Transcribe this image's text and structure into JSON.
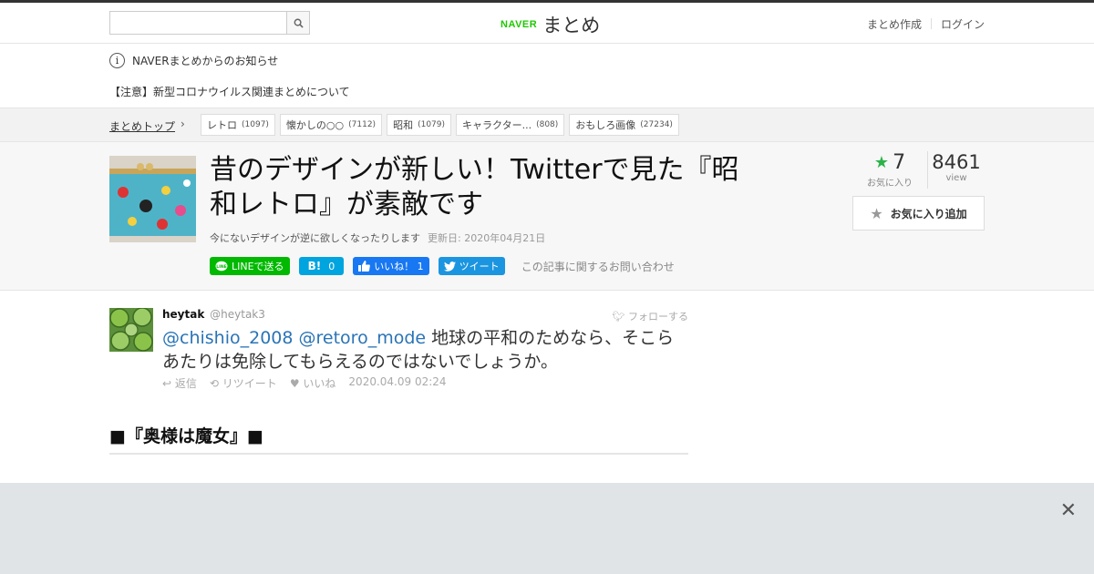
{
  "header": {
    "logo_naver": "NAVER",
    "logo_matome": "まとめ",
    "search_placeholder": "",
    "links": [
      "まとめ作成",
      "ログイン"
    ]
  },
  "notice": {
    "title": "NAVERまとめからのお知らせ",
    "item": "【注意】新型コロナウイルス関連まとめについて"
  },
  "breadcrumb": {
    "top": "まとめトップ",
    "tags": [
      {
        "label": "レトロ",
        "count": "(1097)"
      },
      {
        "label": "懐かしの○○",
        "count": "(7112)"
      },
      {
        "label": "昭和",
        "count": "(1079)"
      },
      {
        "label": "キャラクター...",
        "count": "(808)"
      },
      {
        "label": "おもしろ画像",
        "count": "(27234)"
      }
    ]
  },
  "article": {
    "title": "昔のデザインが新しい！Twitterで見た『昭和レトロ』が素敵です",
    "description": "今にないデザインが逆に欲しくなったりします",
    "updated": "更新日: 2020年04月21日",
    "favorites": "7",
    "favorites_label": "お気に入り",
    "views": "8461",
    "views_label": "view",
    "fav_button": "お気に入り追加",
    "social": {
      "line": "LINEで送る",
      "hatena": "0",
      "fb": "いいね！ 1",
      "tweet": "ツイート"
    },
    "contact": "この記事に関するお問い合わせ"
  },
  "tweet": {
    "name": "heytak",
    "handle": "@heytak3",
    "follow": "フォローする",
    "mention1": "@chishio_2008",
    "mention2": "@retoro_mode",
    "text": " 地球の平和のためなら、そこらあたりは免除してもらえるのではないでしょうか。",
    "reply": "返信",
    "retweet": "リツイート",
    "like": "いいね",
    "time": "2020.04.09 02:24"
  },
  "section_heading": "■『奥様は魔女』■",
  "colors": {
    "accent_green": "#2cb24a",
    "naver_green": "#1ec800",
    "link_blue": "#2a74b6"
  }
}
